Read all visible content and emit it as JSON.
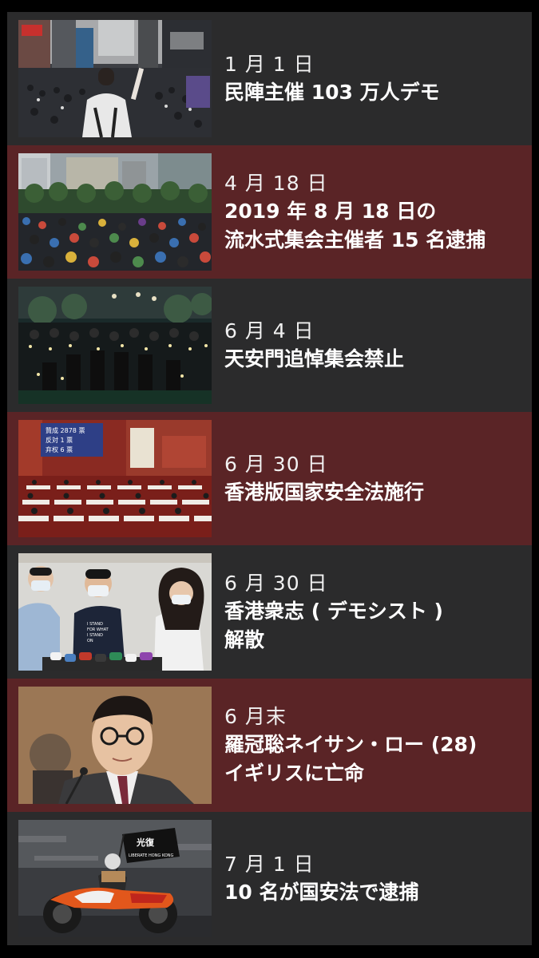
{
  "colors": {
    "background": "#000000",
    "row_dark": "#2b2b2c",
    "row_red": "#5a2426",
    "text": "#ffffff"
  },
  "events": [
    {
      "date": "1 月 1 日",
      "lines": [
        "民陣主催 103 万人デモ"
      ]
    },
    {
      "date": "4 月 18 日",
      "lines": [
        "2019 年 8 月 18 日の",
        "流水式集会主催者 15 名逮捕"
      ]
    },
    {
      "date": "6 月 4 日",
      "lines": [
        "天安門追悼集会禁止"
      ]
    },
    {
      "date": "6 月 30 日",
      "lines": [
        "香港版国家安全法施行"
      ]
    },
    {
      "date": "6 月 30 日",
      "lines": [
        "香港衆志 ( デモシスト )",
        "解散"
      ]
    },
    {
      "date": "6 月末",
      "lines": [
        "羅冠聡ネイサン・ロー (28)",
        "イギリスに亡命"
      ]
    },
    {
      "date": "7 月 1 日",
      "lines": [
        "10 名が国安法で逮捕"
      ]
    }
  ],
  "photo_text": {
    "vote_board": [
      "贊成 2878 票",
      "反対 1 票",
      "弃权 6 票"
    ],
    "tshirt": [
      "I STAND",
      "FOR WHAT",
      "I STAND",
      "ON"
    ],
    "banner": [
      "光復",
      "LIBERATE HONG KONG"
    ]
  }
}
